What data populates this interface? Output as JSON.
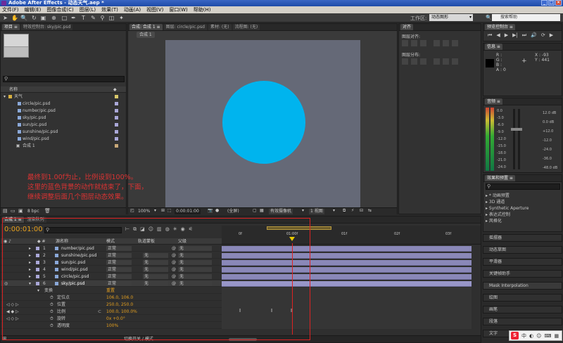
{
  "window": {
    "title": "Adobe After Effects - 动态天气.aep *",
    "min": "_",
    "max": "□",
    "close": "×"
  },
  "menu": [
    "文件(F)",
    "编辑(E)",
    "图像合成(C)",
    "图层(L)",
    "效果(T)",
    "动画(A)",
    "视图(V)",
    "窗口(W)",
    "帮助(H)"
  ],
  "toolbar": {
    "workspace_label": "工作区:",
    "workspace_value": "动态图形",
    "help_placeholder": "搜索帮助"
  },
  "project": {
    "tab_project": "项目 ≡",
    "tab_effects": "特效控制台: sky/pic.psd",
    "col_name": "名称",
    "items": [
      {
        "name": "天气",
        "type": "folder"
      },
      {
        "name": "circle/pic.psd"
      },
      {
        "name": "number/pic.psd"
      },
      {
        "name": "sky/pic.psd"
      },
      {
        "name": "sun/pic.psd"
      },
      {
        "name": "sunshine/pic.psd"
      },
      {
        "name": "wind/pic.psd"
      },
      {
        "name": "合成 1",
        "type": "comp"
      }
    ],
    "bpc": "8 bpc"
  },
  "composition": {
    "tab_comp": "合成: 合成 1 ≡",
    "tab_layer": "图层: circle/pic.psd",
    "tab_footage": "素材: (无)",
    "tab_flow": "流程图: (无)",
    "comp_label": "合成 1",
    "circle_color": "#00b4ee",
    "canvas_color": "#656977",
    "zoom": "100%",
    "timecode": "0:00:01:00",
    "quality": "(全屏)",
    "camera": "有效摄像机",
    "view": "1 视图"
  },
  "align": {
    "title": "对齐",
    "align_layers": "图层对齐:",
    "distribute": "图层分布:"
  },
  "preview": {
    "title": "预览控制台 ≡"
  },
  "info": {
    "title": "信息 ≡",
    "r": "R :",
    "g": "G :",
    "b": "B :",
    "a": "A : 0",
    "x": "X : -93",
    "y": "Y : 441"
  },
  "audio": {
    "title": "音频 ≡",
    "left_scale": [
      "0.0",
      "-3.0",
      "-6.0",
      "-9.0",
      "-12.0",
      "-15.0",
      "-18.0",
      "-21.0",
      "-24.0"
    ],
    "right_scale": [
      "12.0 dB",
      "0.0 dB",
      "+12.0",
      "-12.0",
      "-24.0",
      "-36.0",
      "-48.0 dB"
    ]
  },
  "effects_presets": {
    "title": "效果和预置 ≡",
    "search": "",
    "items": [
      "* 动画预置",
      "3D 通道",
      "Synthetic Aperture",
      "表达式控制",
      "风格化"
    ]
  },
  "right_panels": [
    "摇摆器",
    "动态草图",
    "平滑器",
    "关键帧助手",
    "Mask Interpolation",
    "绘图",
    "画笔",
    "段落",
    "文字"
  ],
  "timeline": {
    "tab": "合成 1 ≡",
    "tab2": "渲染队列",
    "timecode": "0:00:01:00",
    "search": "",
    "cols": {
      "source": "源名称",
      "mode": "模式",
      "trkmat": "轨道蒙板",
      "parent": "父级"
    },
    "ruler": [
      "0f",
      "01:00f",
      "01f",
      "02f",
      "03f"
    ],
    "layers": [
      {
        "num": "1",
        "name": "number/pic.psd",
        "mode": "正常",
        "trk": "",
        "parent": "无"
      },
      {
        "num": "2",
        "name": "sunshine/pic.psd",
        "mode": "正常",
        "trk": "无",
        "parent": "无"
      },
      {
        "num": "3",
        "name": "sun/pic.psd",
        "mode": "正常",
        "trk": "无",
        "parent": "无"
      },
      {
        "num": "4",
        "name": "wind/pic.psd",
        "mode": "正常",
        "trk": "无",
        "parent": "无"
      },
      {
        "num": "5",
        "name": "circle/pic.psd",
        "mode": "正常",
        "trk": "无",
        "parent": "无"
      },
      {
        "num": "6",
        "name": "sky/pic.psd",
        "mode": "正常",
        "trk": "无",
        "parent": "无"
      }
    ],
    "transform": {
      "label": "变换",
      "reset": "重置"
    },
    "props": [
      {
        "name": "定位点",
        "value": "106.0, 106.0"
      },
      {
        "name": "位置",
        "value": "250.0, 250.0"
      },
      {
        "name": "比例",
        "value": "100.0, 100.0%"
      },
      {
        "name": "旋转",
        "value": "0x +0.0°"
      },
      {
        "name": "透明度",
        "value": "100%"
      }
    ],
    "footer": "切换开关 / 模式"
  },
  "annotation": {
    "line1": "最终到1.00f为止，比例设到100%。",
    "line2": "这里的蓝色背景的动作就结束了，下面，",
    "line3": "继续调整后面几个图层动态效果。"
  },
  "ime": {
    "logo": "S",
    "lang": "中"
  }
}
